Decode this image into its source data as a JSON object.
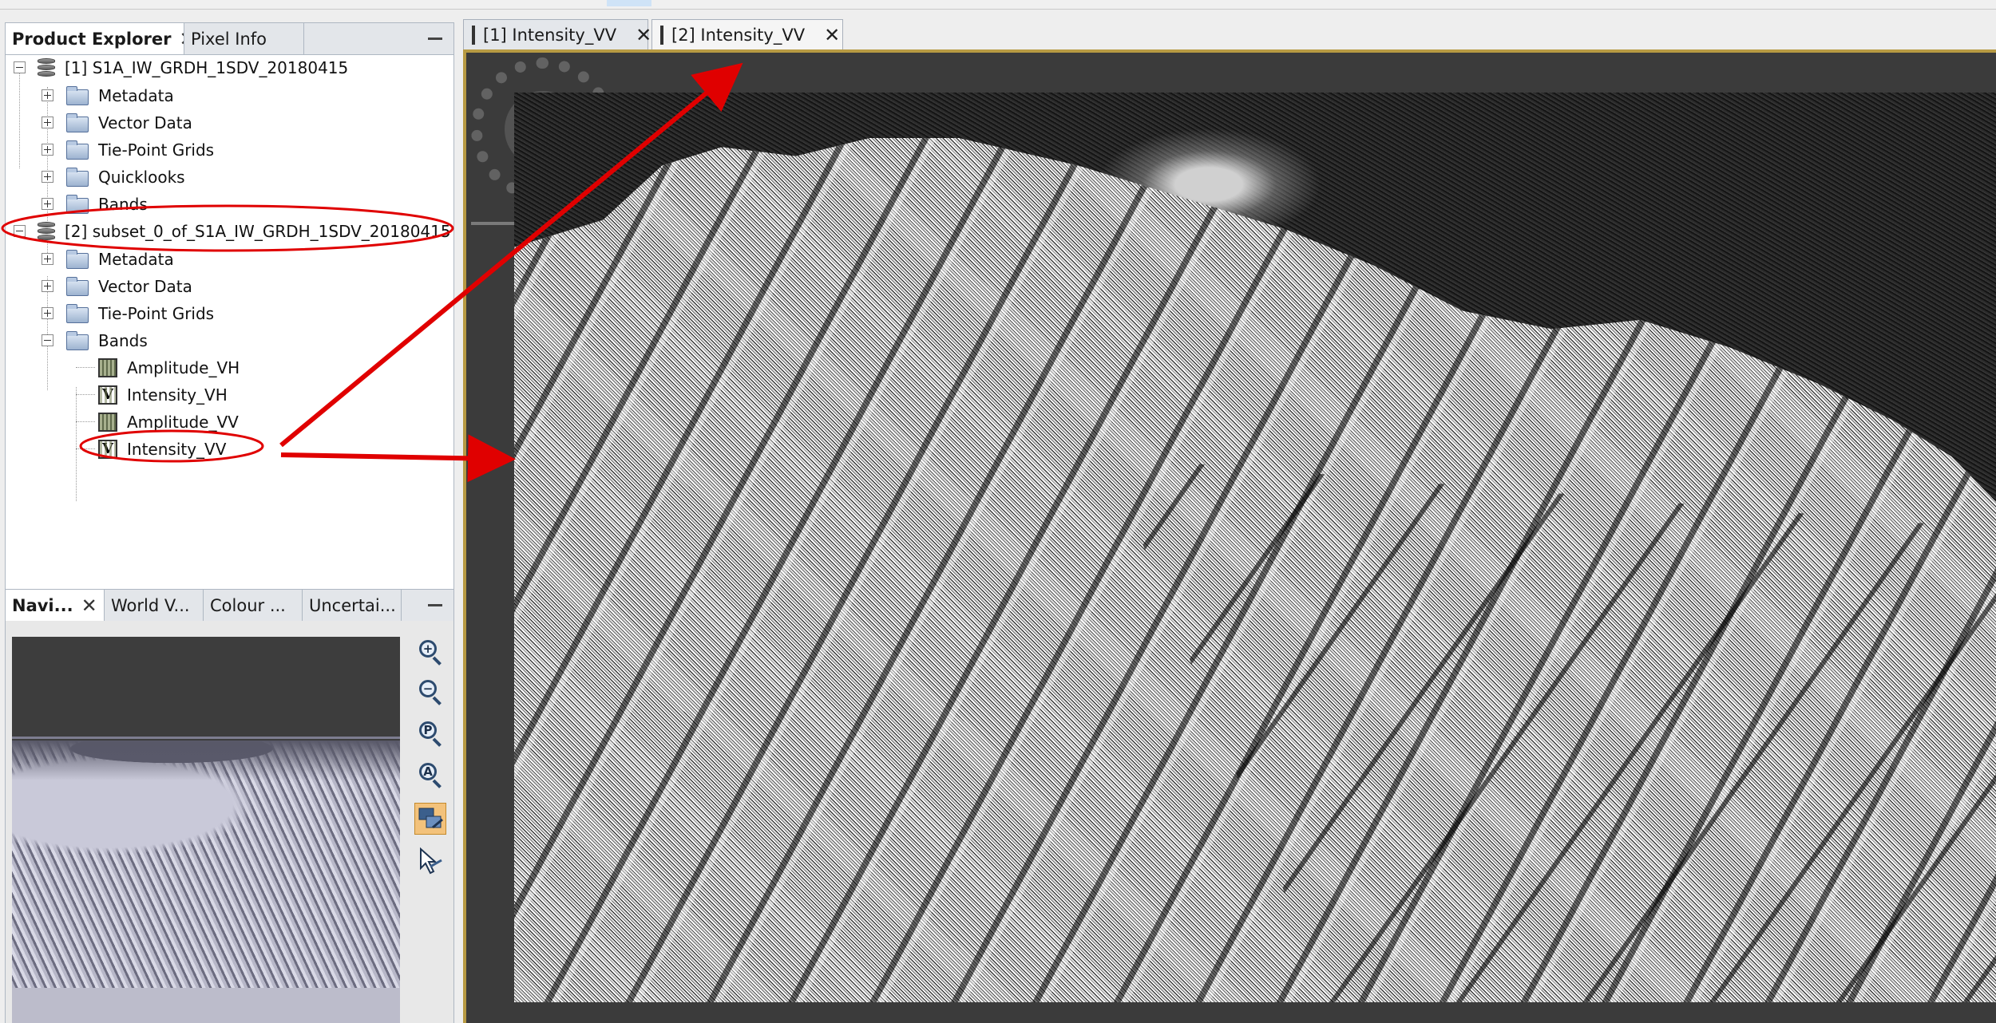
{
  "product_explorer": {
    "tabs": [
      {
        "label": "Product Explorer",
        "active": true
      },
      {
        "label": "Pixel Info",
        "active": false
      }
    ],
    "tree": {
      "product1": {
        "label": "[1] S1A_IW_GRDH_1SDV_20180415",
        "children": [
          "Metadata",
          "Vector Data",
          "Tie-Point Grids",
          "Quicklooks",
          "Bands"
        ]
      },
      "product2": {
        "label": "[2] subset_0_of_S1A_IW_GRDH_1SDV_20180415",
        "children": [
          "Metadata",
          "Vector Data",
          "Tie-Point Grids",
          "Bands"
        ],
        "bands": [
          "Amplitude_VH",
          "Intensity_VH",
          "Amplitude_VV",
          "Intensity_VV"
        ]
      }
    }
  },
  "navigation": {
    "tabs": [
      {
        "label": "Navi...",
        "active": true
      },
      {
        "label": "World V...",
        "active": false
      },
      {
        "label": "Colour ...",
        "active": false
      },
      {
        "label": "Uncertai...",
        "active": false
      }
    ],
    "tools": [
      {
        "icon": "zoom-in-icon",
        "glyph": "+"
      },
      {
        "icon": "zoom-out-icon",
        "glyph": "−"
      },
      {
        "icon": "zoom-pixel-icon",
        "glyph": "P"
      },
      {
        "icon": "zoom-all-icon",
        "glyph": "A"
      },
      {
        "icon": "sync-views-icon",
        "selected": true
      },
      {
        "icon": "sync-cursor-icon"
      }
    ]
  },
  "view": {
    "tabs": [
      {
        "label": "[1] Intensity_VV",
        "active": false
      },
      {
        "label": "[2] Intensity_VV",
        "active": true
      }
    ],
    "image_description": "SAR intensity image of coastline with mountain ridges"
  },
  "colors": {
    "annotation_red": "#e00000",
    "view_border": "#b79a43",
    "selected_tool": "#f3c27b"
  }
}
